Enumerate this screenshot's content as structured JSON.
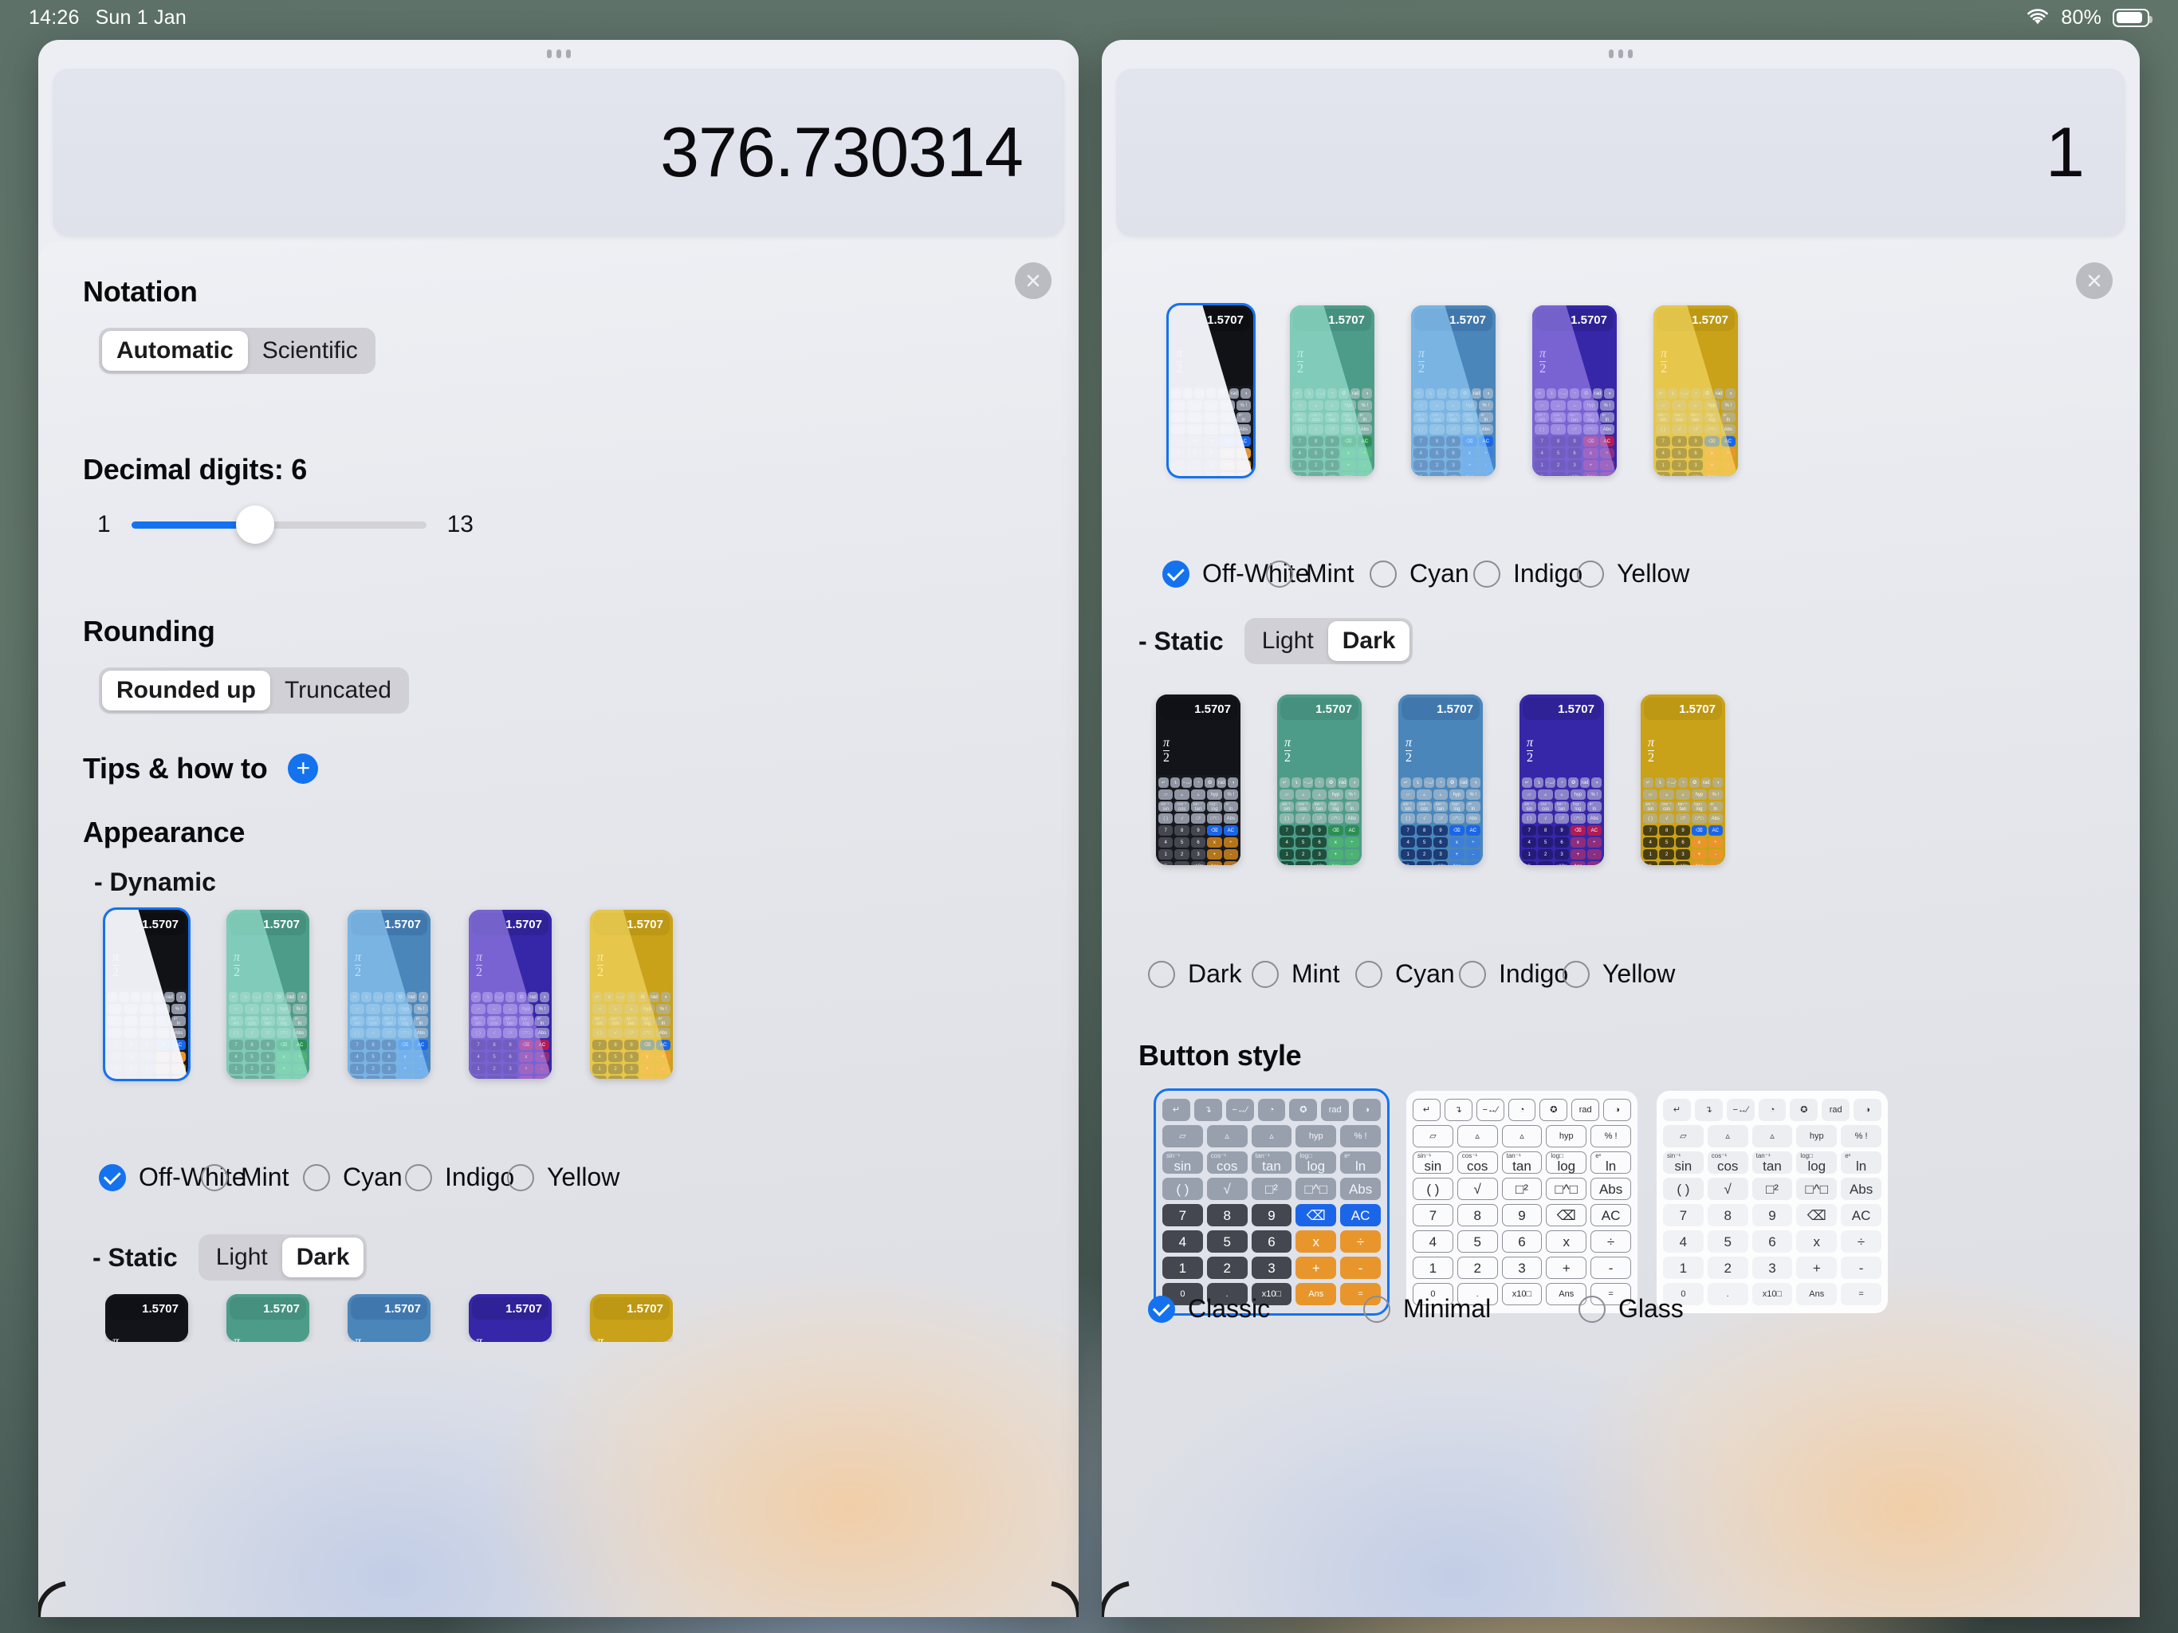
{
  "statusbar": {
    "time": "14:26",
    "date": "Sun 1 Jan",
    "battery_percent": "80%",
    "wifi_icon": "wifi-icon",
    "battery_icon": "battery-icon"
  },
  "left_window": {
    "display_value": "376.730314",
    "close_label": "×",
    "notation": {
      "title": "Notation",
      "options": [
        "Automatic",
        "Scientific"
      ],
      "selected": "Automatic"
    },
    "decimal": {
      "title": "Decimal digits: 6",
      "value": 6,
      "min_label": "1",
      "max_label": "13",
      "min": 1,
      "max": 13
    },
    "rounding": {
      "title": "Rounding",
      "options": [
        "Rounded up",
        "Truncated"
      ],
      "selected": "Rounded up"
    },
    "tips": {
      "title": "Tips & how to",
      "expand_label": "+"
    },
    "appearance": {
      "title": "Appearance",
      "dynamic_label": "- Dynamic",
      "dynamic_themes": [
        "Off-White",
        "Mint",
        "Cyan",
        "Indigo",
        "Yellow"
      ],
      "dynamic_selected": "Off-White",
      "static_label": "- Static",
      "static_modes": [
        "Light",
        "Dark"
      ],
      "static_mode_selected": "Dark"
    }
  },
  "right_window": {
    "display_value": "1",
    "close_label": "×",
    "dynamic_themes": [
      "Off-White",
      "Mint",
      "Cyan",
      "Indigo",
      "Yellow"
    ],
    "dynamic_selected": "Off-White",
    "static_label": "- Static",
    "static_modes": [
      "Light",
      "Dark"
    ],
    "static_mode_selected": "Dark",
    "static_themes": [
      "Dark",
      "Mint",
      "Cyan",
      "Indigo",
      "Yellow"
    ],
    "static_selected": "",
    "button_style": {
      "title": "Button style",
      "options": [
        "Classic",
        "Minimal",
        "Glass"
      ],
      "selected": "Classic"
    }
  },
  "preview": {
    "readout": "1.5707",
    "fraction_numerator": "π",
    "fraction_denominator": "2",
    "keys": {
      "row1": [
        "↵",
        "↴",
        "−↔∕",
        "◔",
        "✪",
        "rad",
        "◑"
      ],
      "row2": [
        "▱",
        "▵",
        "▵",
        "hyp",
        "% !"
      ],
      "row3": [
        "sin",
        "cos",
        "tan",
        "log",
        "ln"
      ],
      "row3_sup": [
        "sin⁻¹",
        "cos⁻¹",
        "tan⁻¹",
        "log□",
        "eˣ"
      ],
      "row4": [
        "( )",
        "√",
        "□²",
        "□^□",
        "Abs"
      ],
      "row5": [
        "7",
        "8",
        "9",
        "⌫",
        "AC"
      ],
      "row6": [
        "4",
        "5",
        "6",
        "x",
        "÷"
      ],
      "row7": [
        "1",
        "2",
        "3",
        "+",
        "-"
      ],
      "row8": [
        "0",
        ".",
        "x10□",
        "Ans",
        "="
      ]
    }
  },
  "colors": {
    "accent_blue": "#1472ef",
    "theme_offwhite": "#1a1b21",
    "theme_mint": "#4d9c89",
    "theme_cyan": "#4a86ba",
    "theme_indigo": "#3527a8",
    "theme_yellow": "#c9a219",
    "key_orange": "#e8962c",
    "key_blue": "#1b66e8",
    "key_dark": "#44474f"
  }
}
